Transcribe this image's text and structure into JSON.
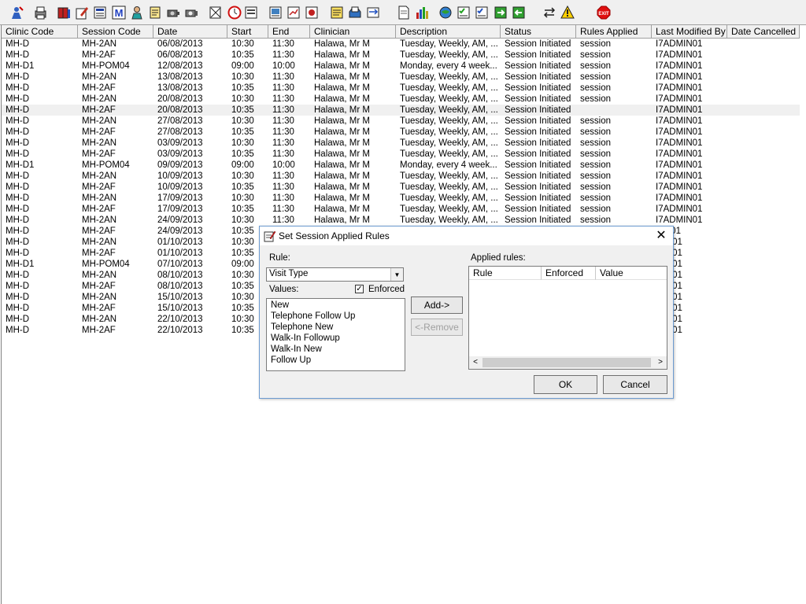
{
  "toolbar": {
    "icons": [
      "user-tools-icon",
      "print-icon",
      "books-icon",
      "edit-note-icon",
      "document-list-icon",
      "mail-m-icon",
      "person-icon",
      "notepad-icon",
      "camera-icon",
      "camera-alt-icon",
      "scan-icon",
      "clock-icon",
      "form-icon",
      "image-icon",
      "chart-form-icon",
      "globe-form-icon",
      "note-icon",
      "tray-icon",
      "transfer-icon",
      "page-icon",
      "bar-chart-icon",
      "globe-search-icon",
      "checklist-icon",
      "checklist-alt-icon",
      "green-arrow-icon",
      "green-arrow-alt-icon",
      "swap-icon",
      "warning-icon",
      "exit-icon"
    ]
  },
  "grid": {
    "columns": [
      "Clinic Code",
      "Session Code",
      "Date",
      "Start",
      "End",
      "Clinician",
      "Description",
      "Status",
      "Rules Applied",
      "Last Modified By",
      "Date Cancelled"
    ],
    "selected_row": 6,
    "rows": [
      [
        "MH-D",
        "MH-2AN",
        "06/08/2013",
        "10:30",
        "11:30",
        "Halawa, Mr M",
        "Tuesday, Weekly, AM, ...",
        "Session Initiated",
        "session",
        "I7ADMIN01",
        ""
      ],
      [
        "MH-D",
        "MH-2AF",
        "06/08/2013",
        "10:35",
        "11:30",
        "Halawa, Mr M",
        "Tuesday, Weekly, AM, ...",
        "Session Initiated",
        "session",
        "I7ADMIN01",
        ""
      ],
      [
        "MH-D1",
        "MH-POM04",
        "12/08/2013",
        "09:00",
        "10:00",
        "Halawa, Mr M",
        "Monday, every 4 week...",
        "Session Initiated",
        "session",
        "I7ADMIN01",
        ""
      ],
      [
        "MH-D",
        "MH-2AN",
        "13/08/2013",
        "10:30",
        "11:30",
        "Halawa, Mr M",
        "Tuesday, Weekly, AM, ...",
        "Session Initiated",
        "session",
        "I7ADMIN01",
        ""
      ],
      [
        "MH-D",
        "MH-2AF",
        "13/08/2013",
        "10:35",
        "11:30",
        "Halawa, Mr M",
        "Tuesday, Weekly, AM, ...",
        "Session Initiated",
        "session",
        "I7ADMIN01",
        ""
      ],
      [
        "MH-D",
        "MH-2AN",
        "20/08/2013",
        "10:30",
        "11:30",
        "Halawa, Mr M",
        "Tuesday, Weekly, AM, ...",
        "Session Initiated",
        "session",
        "I7ADMIN01",
        ""
      ],
      [
        "MH-D",
        "MH-2AF",
        "20/08/2013",
        "10:35",
        "11:30",
        "Halawa, Mr M",
        "Tuesday, Weekly, AM, ...",
        "Session Initiated",
        "",
        "I7ADMIN01",
        ""
      ],
      [
        "MH-D",
        "MH-2AN",
        "27/08/2013",
        "10:30",
        "11:30",
        "Halawa, Mr M",
        "Tuesday, Weekly, AM, ...",
        "Session Initiated",
        "session",
        "I7ADMIN01",
        ""
      ],
      [
        "MH-D",
        "MH-2AF",
        "27/08/2013",
        "10:35",
        "11:30",
        "Halawa, Mr M",
        "Tuesday, Weekly, AM, ...",
        "Session Initiated",
        "session",
        "I7ADMIN01",
        ""
      ],
      [
        "MH-D",
        "MH-2AN",
        "03/09/2013",
        "10:30",
        "11:30",
        "Halawa, Mr M",
        "Tuesday, Weekly, AM, ...",
        "Session Initiated",
        "session",
        "I7ADMIN01",
        ""
      ],
      [
        "MH-D",
        "MH-2AF",
        "03/09/2013",
        "10:35",
        "11:30",
        "Halawa, Mr M",
        "Tuesday, Weekly, AM, ...",
        "Session Initiated",
        "session",
        "I7ADMIN01",
        ""
      ],
      [
        "MH-D1",
        "MH-POM04",
        "09/09/2013",
        "09:00",
        "10:00",
        "Halawa, Mr M",
        "Monday, every 4 week...",
        "Session Initiated",
        "session",
        "I7ADMIN01",
        ""
      ],
      [
        "MH-D",
        "MH-2AN",
        "10/09/2013",
        "10:30",
        "11:30",
        "Halawa, Mr M",
        "Tuesday, Weekly, AM, ...",
        "Session Initiated",
        "session",
        "I7ADMIN01",
        ""
      ],
      [
        "MH-D",
        "MH-2AF",
        "10/09/2013",
        "10:35",
        "11:30",
        "Halawa, Mr M",
        "Tuesday, Weekly, AM, ...",
        "Session Initiated",
        "session",
        "I7ADMIN01",
        ""
      ],
      [
        "MH-D",
        "MH-2AN",
        "17/09/2013",
        "10:30",
        "11:30",
        "Halawa, Mr M",
        "Tuesday, Weekly, AM, ...",
        "Session Initiated",
        "session",
        "I7ADMIN01",
        ""
      ],
      [
        "MH-D",
        "MH-2AF",
        "17/09/2013",
        "10:35",
        "11:30",
        "Halawa, Mr M",
        "Tuesday, Weekly, AM, ...",
        "Session Initiated",
        "session",
        "I7ADMIN01",
        ""
      ],
      [
        "MH-D",
        "MH-2AN",
        "24/09/2013",
        "10:30",
        "11:30",
        "Halawa, Mr M",
        "Tuesday, Weekly, AM, ...",
        "Session Initiated",
        "session",
        "I7ADMIN01",
        ""
      ],
      [
        "MH-D",
        "MH-2AF",
        "24/09/2013",
        "10:35",
        "",
        "",
        "",
        "",
        "",
        "AIN01",
        ""
      ],
      [
        "MH-D",
        "MH-2AN",
        "01/10/2013",
        "10:30",
        "",
        "",
        "",
        "",
        "",
        "MIN01",
        ""
      ],
      [
        "MH-D",
        "MH-2AF",
        "01/10/2013",
        "10:35",
        "",
        "",
        "",
        "",
        "",
        "MIN01",
        ""
      ],
      [
        "MH-D1",
        "MH-POM04",
        "07/10/2013",
        "09:00",
        "",
        "",
        "",
        "",
        "",
        "MIN01",
        ""
      ],
      [
        "MH-D",
        "MH-2AN",
        "08/10/2013",
        "10:30",
        "",
        "",
        "",
        "",
        "",
        "MIN01",
        ""
      ],
      [
        "MH-D",
        "MH-2AF",
        "08/10/2013",
        "10:35",
        "",
        "",
        "",
        "",
        "",
        "MIN01",
        ""
      ],
      [
        "MH-D",
        "MH-2AN",
        "15/10/2013",
        "10:30",
        "",
        "",
        "",
        "",
        "",
        "MIN01",
        ""
      ],
      [
        "MH-D",
        "MH-2AF",
        "15/10/2013",
        "10:35",
        "",
        "",
        "",
        "",
        "",
        "MIN01",
        ""
      ],
      [
        "MH-D",
        "MH-2AN",
        "22/10/2013",
        "10:30",
        "",
        "",
        "",
        "",
        "",
        "MIN01",
        ""
      ],
      [
        "MH-D",
        "MH-2AF",
        "22/10/2013",
        "10:35",
        "",
        "",
        "",
        "",
        "",
        "MIN01",
        ""
      ]
    ]
  },
  "dialog": {
    "title": "Set Session Applied Rules",
    "close_glyph": "✕",
    "rule_label": "Rule:",
    "rule_value": "Visit Type",
    "values_label": "Values:",
    "enforced_label": "Enforced",
    "enforced_checked": true,
    "values": [
      "New",
      "Telephone Follow Up",
      "Telephone New",
      "Walk-In Followup",
      "Walk-In New",
      "Follow Up"
    ],
    "add_label": "Add->",
    "remove_label": "<-Remove",
    "applied_label": "Applied rules:",
    "applied_columns": [
      "Rule",
      "Enforced",
      "Value"
    ],
    "ok_label": "OK",
    "cancel_label": "Cancel"
  }
}
